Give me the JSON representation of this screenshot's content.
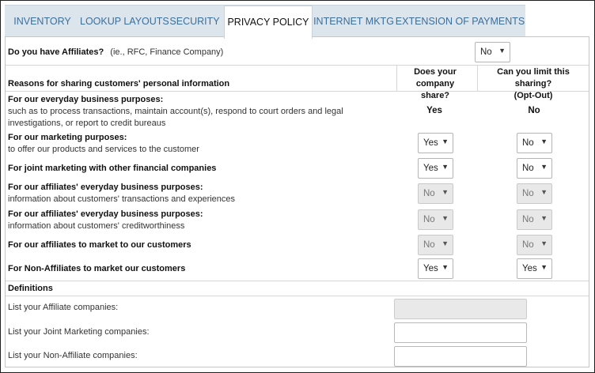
{
  "tabs": [
    {
      "label": "INVENTORY",
      "active": false
    },
    {
      "label": "LOOKUP LAYOUTS",
      "active": false
    },
    {
      "label": "SECURITY",
      "active": false
    },
    {
      "label": "PRIVACY POLICY",
      "active": true
    },
    {
      "label": "INTERNET MKTG",
      "active": false
    },
    {
      "label": "EXTENSION OF PAYMENTS",
      "active": false
    }
  ],
  "affiliates_question": {
    "label": "Do you have Affiliates?",
    "hint": "(ie., RFC, Finance Company)",
    "value": "No"
  },
  "headers": {
    "reasons": "Reasons for sharing customers' personal information",
    "share_line1": "Does your company",
    "share_line2": "share?",
    "limit_line1": "Can you limit this sharing?",
    "limit_line2": "(Opt-Out)"
  },
  "rows": [
    {
      "title": "For our everyday business purposes:",
      "desc1": "such as to process transactions, maintain account(s), respond to court orders and legal",
      "desc2": "investigations, or report to credit bureaus",
      "share": "Yes",
      "limit": "No"
    },
    {
      "title": "For our marketing purposes:",
      "desc1": "to offer our products and services to the customer",
      "desc2": "",
      "share": "Yes",
      "limit": "No"
    },
    {
      "title": "For joint marketing with other financial companies",
      "desc1": "",
      "desc2": "",
      "share": "Yes",
      "limit": "No"
    },
    {
      "title": "For our affiliates' everyday business purposes:",
      "desc1": "information about customers' transactions and experiences",
      "desc2": "",
      "share": "No",
      "limit": "No"
    },
    {
      "title": "For our affiliates' everyday business purposes:",
      "desc1": "information about customers' creditworthiness",
      "desc2": "",
      "share": "No",
      "limit": "No"
    },
    {
      "title": "For our affiliates to market to our customers",
      "desc1": "",
      "desc2": "",
      "share": "No",
      "limit": "No"
    },
    {
      "title": "For Non-Affiliates to market our customers",
      "desc1": "",
      "desc2": "",
      "share": "Yes",
      "limit": "Yes"
    }
  ],
  "definitions": {
    "heading": "Definitions",
    "affiliate_label": "List your Affiliate companies:",
    "affiliate_value": "",
    "joint_label": "List your Joint Marketing companies:",
    "joint_value": "",
    "nonaffiliate_label": "List your Non-Affiliate companies:",
    "nonaffiliate_value": ""
  },
  "icons": {
    "dropdown": "triangle-down-icon"
  },
  "colors": {
    "tab_bar": "#dce4ec",
    "tab_text": "#3b6f9c",
    "disabled_field": "#e8e8e8"
  }
}
